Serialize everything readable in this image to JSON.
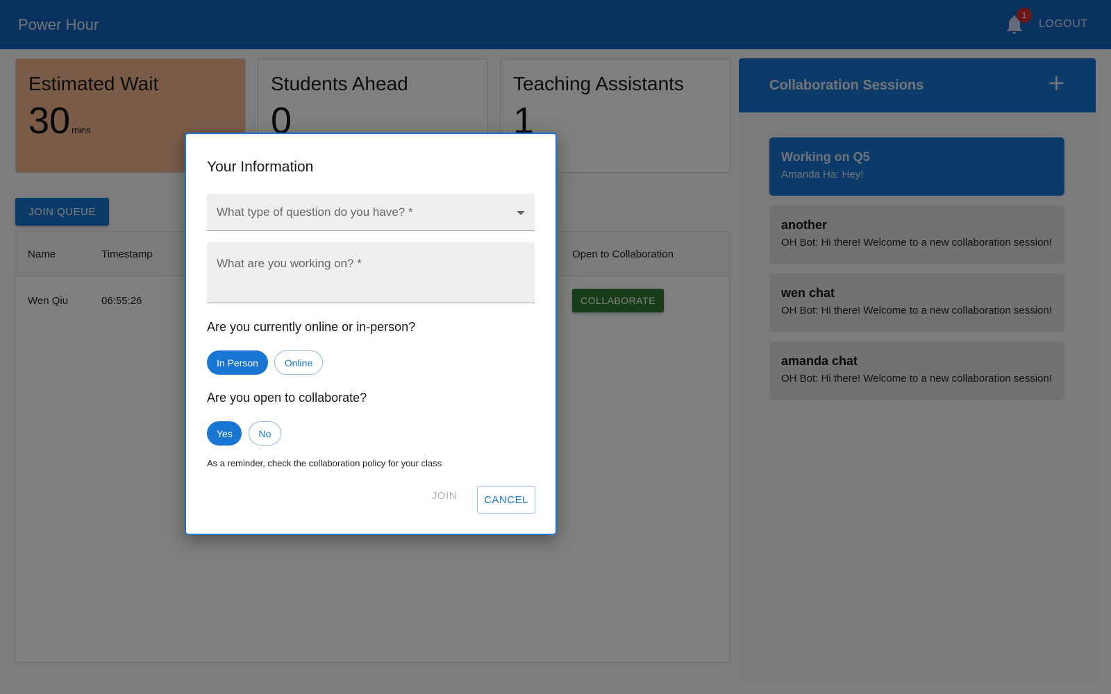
{
  "app": {
    "title": "Power Hour",
    "notification_count": "1",
    "logout_label": "LOGOUT"
  },
  "stats": {
    "wait": {
      "label": "Estimated Wait",
      "value": "30",
      "unit": "mins"
    },
    "ahead": {
      "label": "Students Ahead",
      "value": "0"
    },
    "tas": {
      "label": "Teaching Assistants",
      "value": "1"
    }
  },
  "queue": {
    "join_label": "JOIN QUEUE",
    "columns": {
      "name": "Name",
      "timestamp": "Timestamp",
      "collab": "Open to Collaboration"
    },
    "rows": [
      {
        "name": "Wen Qiu",
        "timestamp": "06:55:26",
        "action": "COLLABORATE"
      }
    ]
  },
  "sessions": {
    "title": "Collaboration Sessions",
    "add_glyph": "+",
    "items": [
      {
        "title": "Working on Q5",
        "message": "Amanda Ha: Hey!",
        "active": true
      },
      {
        "title": "another",
        "message": "OH Bot: Hi there! Welcome to a new collaboration session!",
        "active": false
      },
      {
        "title": "wen chat",
        "message": "OH Bot: Hi there! Welcome to a new collaboration session!",
        "active": false
      },
      {
        "title": "amanda chat",
        "message": "OH Bot: Hi there! Welcome to a new collaboration session!",
        "active": false
      }
    ]
  },
  "dialog": {
    "title": "Your Information",
    "question_type_placeholder": "What type of question do you have? *",
    "working_on_placeholder": "What are you working on? *",
    "location_question": "Are you currently online or in-person?",
    "location_options": {
      "in_person": "In Person",
      "online": "Online"
    },
    "location_selected": "In Person",
    "collab_question": "Are you open to collaborate?",
    "collab_options": {
      "yes": "Yes",
      "no": "No"
    },
    "collab_selected": "Yes",
    "reminder": "As a reminder, check the collaboration policy for your class",
    "join_label": "JOIN",
    "cancel_label": "CANCEL"
  },
  "colors": {
    "primary": "#1976d2",
    "appbar": "#1565c0",
    "wait_card": "#f3b690",
    "collaborate": "#2e7d32",
    "badge": "#d32f2f"
  }
}
